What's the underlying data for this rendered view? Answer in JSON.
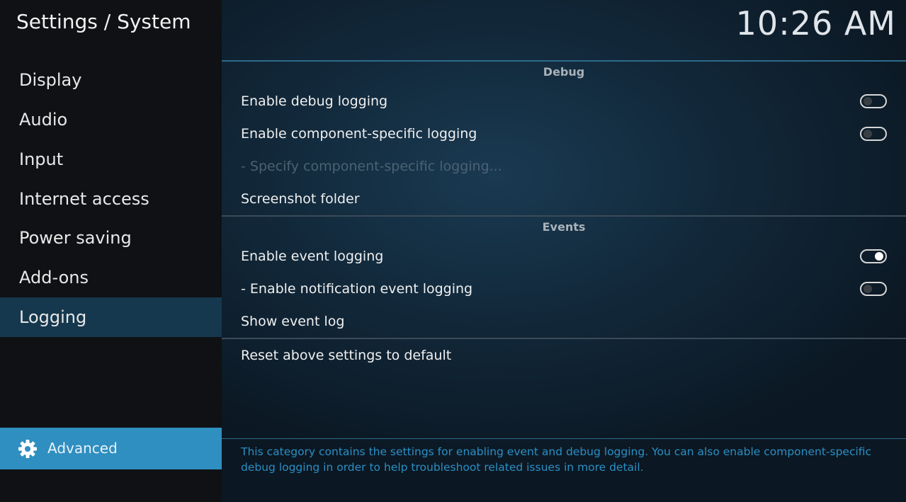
{
  "header": {
    "title": "Settings / System",
    "clock": "10:26 AM"
  },
  "sidebar": {
    "items": [
      {
        "label": "Display"
      },
      {
        "label": "Audio"
      },
      {
        "label": "Input"
      },
      {
        "label": "Internet access"
      },
      {
        "label": "Power saving"
      },
      {
        "label": "Add-ons"
      },
      {
        "label": "Logging",
        "active": true
      }
    ],
    "level_button": {
      "label": "Advanced",
      "icon": "gear-icon"
    }
  },
  "settings": {
    "debug": {
      "title": "Debug",
      "enable_debug_logging": {
        "label": "Enable debug logging",
        "enabled": false
      },
      "enable_component_logging": {
        "label": "Enable component-specific logging",
        "enabled": false
      },
      "specify_component_logging": {
        "label": "- Specify component-specific logging...",
        "disabled": true
      },
      "screenshot_folder": {
        "label": "Screenshot folder"
      }
    },
    "events": {
      "title": "Events",
      "enable_event_logging": {
        "label": "Enable event logging",
        "enabled": true
      },
      "enable_notification_event_logging": {
        "label": "- Enable notification event logging",
        "enabled": false
      },
      "show_event_log": {
        "label": "Show event log"
      }
    },
    "reset": {
      "label": "Reset above settings to default"
    }
  },
  "description": "This category contains the settings for enabling event and debug logging. You can also enable component-specific debug logging in order to help troubleshoot related issues in more detail.",
  "colors": {
    "accent": "#2f8fc0",
    "active_item": "#15384e",
    "description": "#2a8fc4"
  }
}
